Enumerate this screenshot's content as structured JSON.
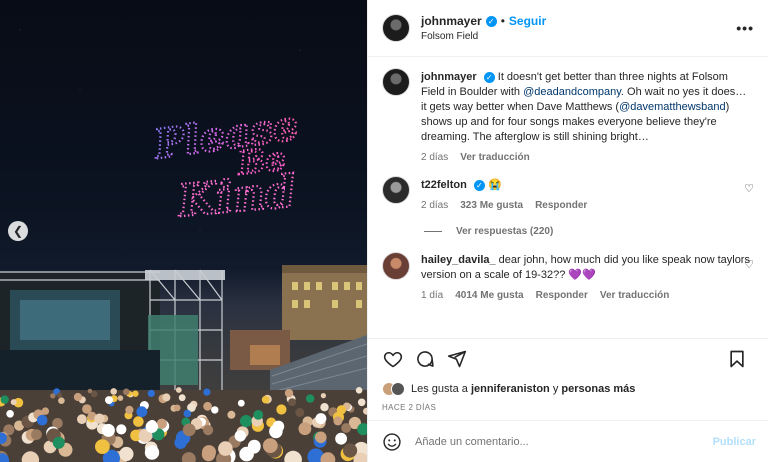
{
  "post": {
    "media_text": [
      "Please",
      "Be",
      "Kind"
    ],
    "author": "johnmayer",
    "follow_label": "Seguir",
    "separator": "•",
    "location": "Folsom Field",
    "more_label": "•••"
  },
  "caption": {
    "author": "johnmayer",
    "text_1": "It doesn't get better than three nights at Folsom Field in Boulder with ",
    "mention_1": "@deadandcompany",
    "text_2": ". Oh wait no yes it does… it gets way better when Dave Matthews (",
    "mention_2": "@davematthewsband",
    "text_3": ") shows up and for four songs makes everyone believe they're dreaming. The afterglow is still shining bright…",
    "time": "2 días",
    "translate": "Ver traducción"
  },
  "comments": [
    {
      "author": "t22felton",
      "text": "😭",
      "time": "2 días",
      "likes": "323 Me gusta",
      "reply": "Responder",
      "view_replies": "Ver respuestas (220)"
    },
    {
      "author": "hailey_davila_",
      "text": "dear john, how much did you like speak now taylors version on a scale of 19-32?? 💜💜",
      "time": "1 día",
      "likes": "4014 Me gusta",
      "reply": "Responder",
      "translate": "Ver traducción"
    }
  ],
  "likes": {
    "prefix": "Les gusta a ",
    "user": "jenniferaniston",
    "connector": " y ",
    "rest": "personas más"
  },
  "posted_ago": "HACE 2 DÍAS",
  "composer": {
    "placeholder": "Añade un comentario...",
    "publish": "Publicar"
  },
  "colors": {
    "accent": "#0095f6",
    "mention": "#00376b",
    "muted": "#737373",
    "publish_disabled": "#b2dffc",
    "drone_pink": "#ff5fc8",
    "drone_blue": "#6e86ff"
  },
  "icons": [
    "chevron-left-icon",
    "verified-icon",
    "heart-icon",
    "comment-icon",
    "share-icon",
    "bookmark-icon",
    "emoji-icon",
    "more-icon"
  ]
}
